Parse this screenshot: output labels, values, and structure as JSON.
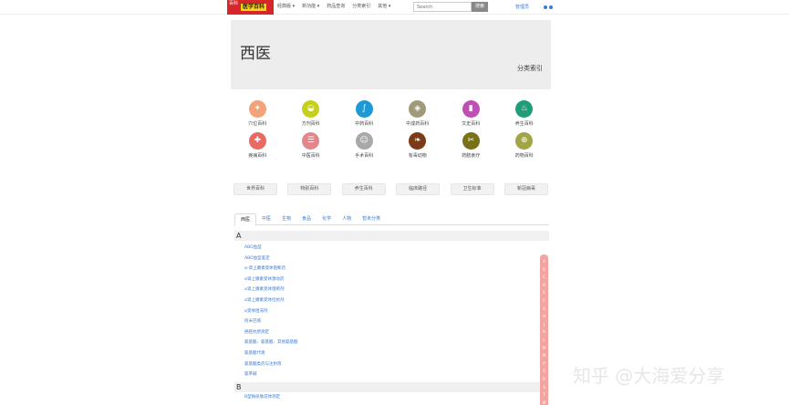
{
  "topbar": {
    "logo_left": "百科",
    "logo_text": "医学百科",
    "nav": [
      "经典版 ▾",
      "新功能 ▾",
      "药品查询",
      "分类索引",
      "其他 ▾"
    ],
    "search_placeholder": "Search",
    "search_button": "搜索",
    "manage_label": "管理员"
  },
  "header": {
    "title": "西医",
    "index_link": "分类索引"
  },
  "icons": [
    {
      "label": "穴位百科",
      "color": "#f2a37a",
      "glyph": "✦",
      "icon": "acupoint-icon"
    },
    {
      "label": "方剂百科",
      "color": "#c5cf1c",
      "glyph": "◒",
      "icon": "prescription-icon"
    },
    {
      "label": "中药百科",
      "color": "#1d9ad6",
      "glyph": "∫",
      "icon": "herb-icon"
    },
    {
      "label": "中成药百科",
      "color": "#a19a7a",
      "glyph": "◈",
      "icon": "patent-medicine-icon"
    },
    {
      "label": "文史百科",
      "color": "#c04fb5",
      "glyph": "▮",
      "icon": "history-icon"
    },
    {
      "label": "养生百科",
      "color": "#1f9c78",
      "glyph": "♨",
      "icon": "health-icon"
    },
    {
      "label": "疾病百科",
      "color": "#e96a63",
      "glyph": "✚",
      "icon": "disease-icon"
    },
    {
      "label": "中医百科",
      "color": "#e3868b",
      "glyph": "☰",
      "icon": "tcm-icon"
    },
    {
      "label": "手术百科",
      "color": "#a8a8a8",
      "glyph": "☺",
      "icon": "surgery-icon"
    },
    {
      "label": "有毒动物",
      "color": "#7a3b16",
      "glyph": "❧",
      "icon": "poisonous-animal-icon"
    },
    {
      "label": "药膳食疗",
      "color": "#7a7018",
      "glyph": "✂",
      "icon": "diet-therapy-icon"
    },
    {
      "label": "药物百科",
      "color": "#a2a545",
      "glyph": "⊕",
      "icon": "drug-icon"
    }
  ],
  "buttons": [
    "世界百科",
    "特别百科",
    "养生百科",
    "临床路径",
    "卫生标准",
    "新冠病毒"
  ],
  "tabs": [
    "西医",
    "中医",
    "生物",
    "食品",
    "化学",
    "人物",
    "暂未分类"
  ],
  "sections": {
    "a_letter": "A",
    "a_entries": [
      "ABO血型",
      "ABO血型鉴定",
      "α-肾上腺素受体阻断药",
      "α肾上腺素受体激动药",
      "α肾上腺素受体阻断剂",
      "α肾上腺素受体拮抗剂",
      "α受体阻滞剂",
      "阿米巴病",
      "癌胚抗原测定",
      "氨基酸、氨基酸、其他氨基酸",
      "氨基酸代谢",
      "氨基酸类药与注射液",
      "氨茶碱"
    ],
    "b_letter": "B",
    "b_entries": [
      "B型钠尿肽前体测定"
    ]
  },
  "alphabet": [
    "A",
    "B",
    "C",
    "D",
    "E",
    "F",
    "G",
    "H",
    "J",
    "K",
    "L",
    "M",
    "N",
    "P",
    "Q",
    "R",
    "S",
    "T",
    "W",
    "X"
  ],
  "watermark": "知乎 @大海爱分享"
}
